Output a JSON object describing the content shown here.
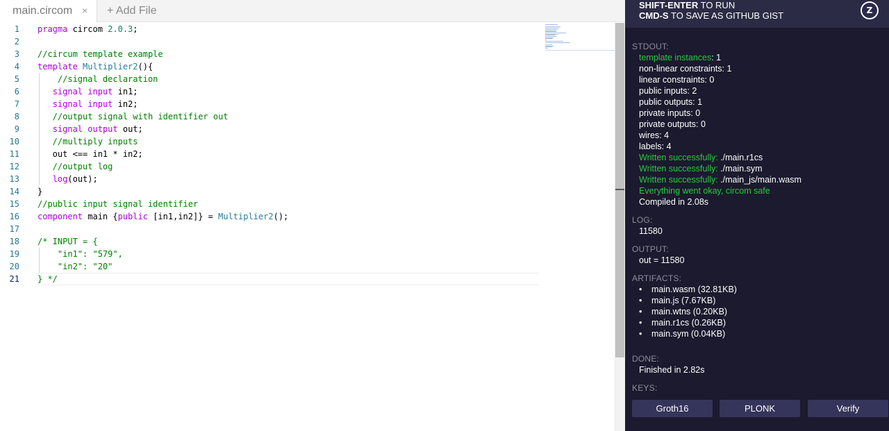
{
  "tabs": {
    "file_name": "main.circom",
    "close_glyph": "×",
    "add_file_label": "+ Add File"
  },
  "editor": {
    "line_numbers": [
      "1",
      "2",
      "3",
      "4",
      "5",
      "6",
      "7",
      "8",
      "9",
      "10",
      "11",
      "12",
      "13",
      "14",
      "15",
      "16",
      "17",
      "18",
      "19",
      "20",
      "21"
    ],
    "active_line": "21"
  },
  "header": {
    "run_key": "SHIFT-ENTER",
    "run_text": " TO RUN",
    "save_key": "CMD-S",
    "save_text": " TO SAVE AS GITHUB GIST",
    "logo_icon": "zk-logo-icon",
    "logo_text": "Z"
  },
  "stdout": {
    "heading": "STDOUT:",
    "template_label": "template instances",
    "template_value": ": 1",
    "lines": [
      "non-linear constraints: 1",
      "linear constraints: 0",
      "public inputs: 2",
      "public outputs: 1",
      "private inputs: 0",
      "private outputs: 0",
      "wires: 4",
      "labels: 4"
    ],
    "written_label": "Written successfully: ",
    "written_files": [
      "./main.r1cs",
      "./main.sym",
      "./main_js/main.wasm"
    ],
    "ok_message": "Everything went okay, circom safe",
    "compiled": "Compiled in 2.08s"
  },
  "log": {
    "heading": "LOG:",
    "value": "11580"
  },
  "output": {
    "heading": "OUTPUT:",
    "value": "out = 11580"
  },
  "artifacts": {
    "heading": "ARTIFACTS:",
    "items": [
      "main.wasm (32.81KB)",
      "main.js (7.67KB)",
      "main.wtns (0.20KB)",
      "main.r1cs (0.26KB)",
      "main.sym (0.04KB)"
    ]
  },
  "done": {
    "heading": "DONE:",
    "value": "Finished in 2.82s"
  },
  "keys": {
    "heading": "KEYS:",
    "groth16": "Groth16",
    "plonk": "PLONK",
    "verify": "Verify"
  },
  "colors": {
    "panel_bg": "#1b1a2e",
    "header_bg": "#2c2b45",
    "success_green": "#27c93f",
    "button_bg": "#35345a"
  }
}
